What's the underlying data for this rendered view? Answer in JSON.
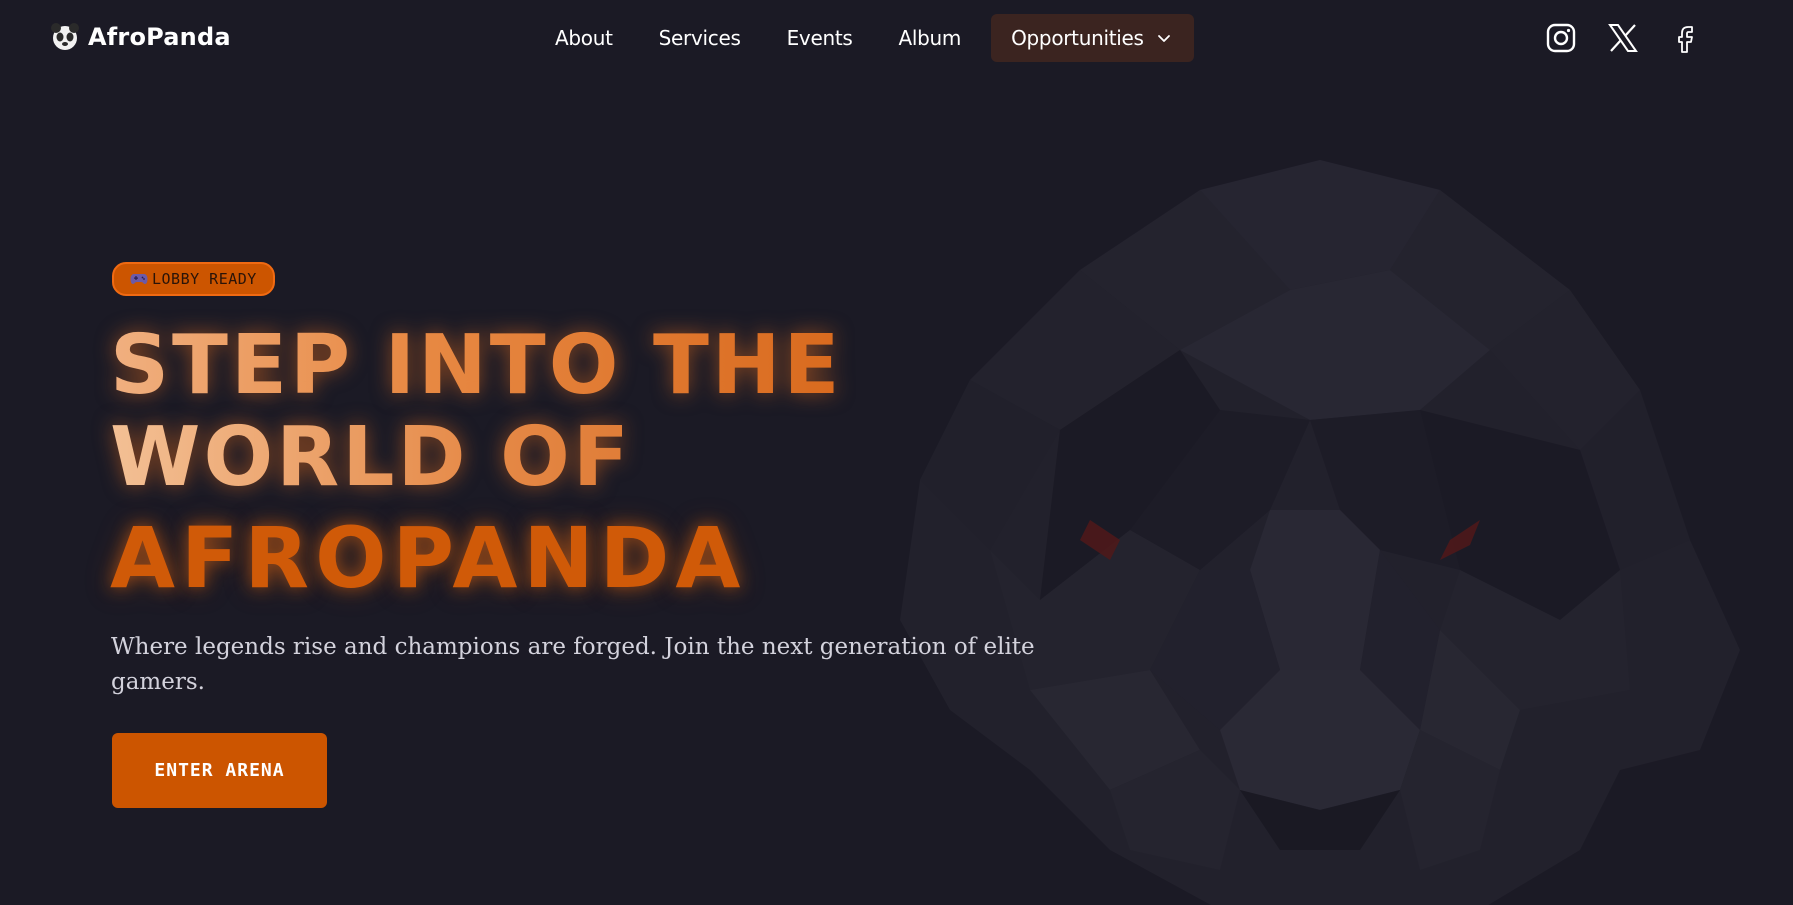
{
  "brand": {
    "name": "AfroPanda",
    "logo_icon": "panda-logo-icon"
  },
  "nav": {
    "items": [
      {
        "label": "About"
      },
      {
        "label": "Services"
      },
      {
        "label": "Events"
      },
      {
        "label": "Album"
      }
    ],
    "dropdown": {
      "label": "Opportunities",
      "icon": "chevron-down-icon"
    }
  },
  "socials": [
    {
      "name": "instagram-icon"
    },
    {
      "name": "x-icon"
    },
    {
      "name": "facebook-icon"
    }
  ],
  "hero": {
    "badge": {
      "icon": "gamepad-icon",
      "label": "LOBBY READY"
    },
    "title_lines": [
      "STEP INTO THE",
      "WORLD OF",
      "AFROPANDA"
    ],
    "subtitle": "Where legends rise and champions are forged. Join the next generation of elite gamers.",
    "cta_label": "ENTER ARENA"
  },
  "colors": {
    "background": "#1b1a25",
    "accent": "#cc5500",
    "dropdown_bg": "#3b2420",
    "text": "#ffffff"
  }
}
